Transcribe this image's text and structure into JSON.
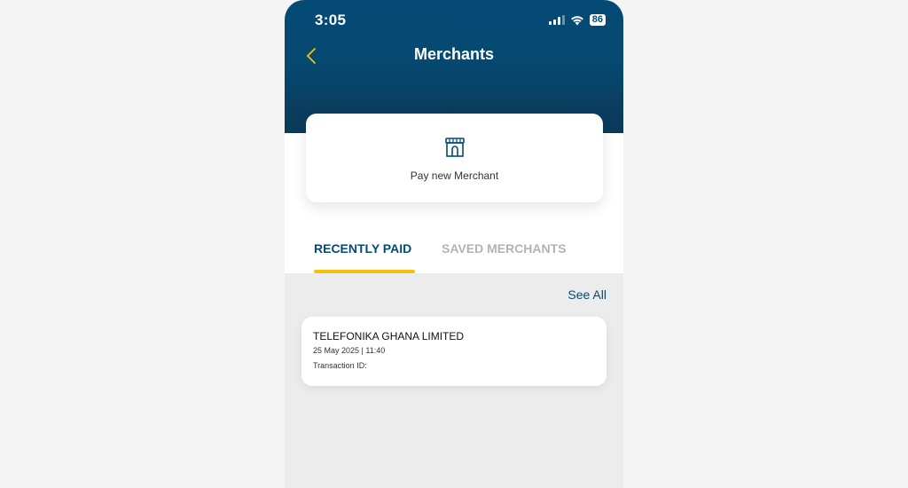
{
  "status_bar": {
    "time": "3:05",
    "battery": "86",
    "icons": [
      "signal-icon",
      "wifi-icon",
      "battery-icon"
    ]
  },
  "header": {
    "title": "Merchants",
    "back_icon": "chevron-left-icon"
  },
  "pay_card": {
    "label": "Pay new Merchant",
    "icon": "store-icon"
  },
  "tabs": [
    {
      "label": "RECENTLY PAID",
      "active": true
    },
    {
      "label": "SAVED MERCHANTS",
      "active": false
    }
  ],
  "see_all": "See All",
  "transactions": [
    {
      "merchant": "TELEFONIKA GHANA LIMITED",
      "datetime": "25 May 2025 | 11:40",
      "transaction_id_label": "Transaction ID:"
    }
  ],
  "colors": {
    "primary": "#054a75",
    "accent": "#f4c20d",
    "inactive_tab": "#b3b3b3"
  }
}
